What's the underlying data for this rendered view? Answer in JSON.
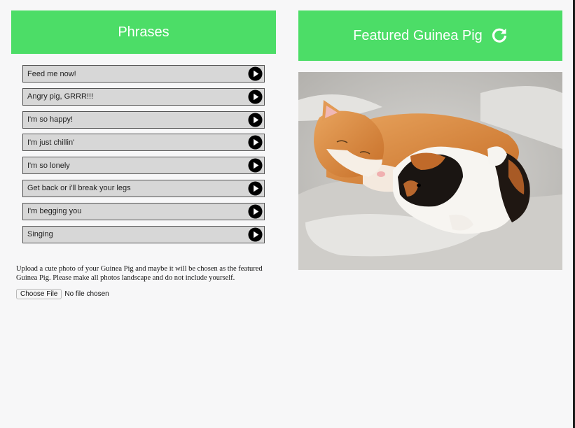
{
  "phrases": {
    "title": "Phrases",
    "items": [
      {
        "label": "Feed me now!"
      },
      {
        "label": "Angry pig, GRRR!!!"
      },
      {
        "label": "I'm so happy!"
      },
      {
        "label": "I'm just chillin'"
      },
      {
        "label": "I'm so lonely"
      },
      {
        "label": "Get back or i'll break your legs"
      },
      {
        "label": "I'm begging you"
      },
      {
        "label": "Singing"
      }
    ]
  },
  "featured": {
    "title": "Featured Guinea Pig",
    "refresh_icon": "refresh-icon"
  },
  "upload": {
    "instructions": "Upload a cute photo of your Guinea Pig and maybe it will be chosen as the featured Guinea Pig. Please make all photos landscape and do not include yourself.",
    "choose_label": "Choose File",
    "status": "No file chosen"
  },
  "colors": {
    "header_green": "#4cdd67",
    "row_gray": "#d7d7d7"
  }
}
